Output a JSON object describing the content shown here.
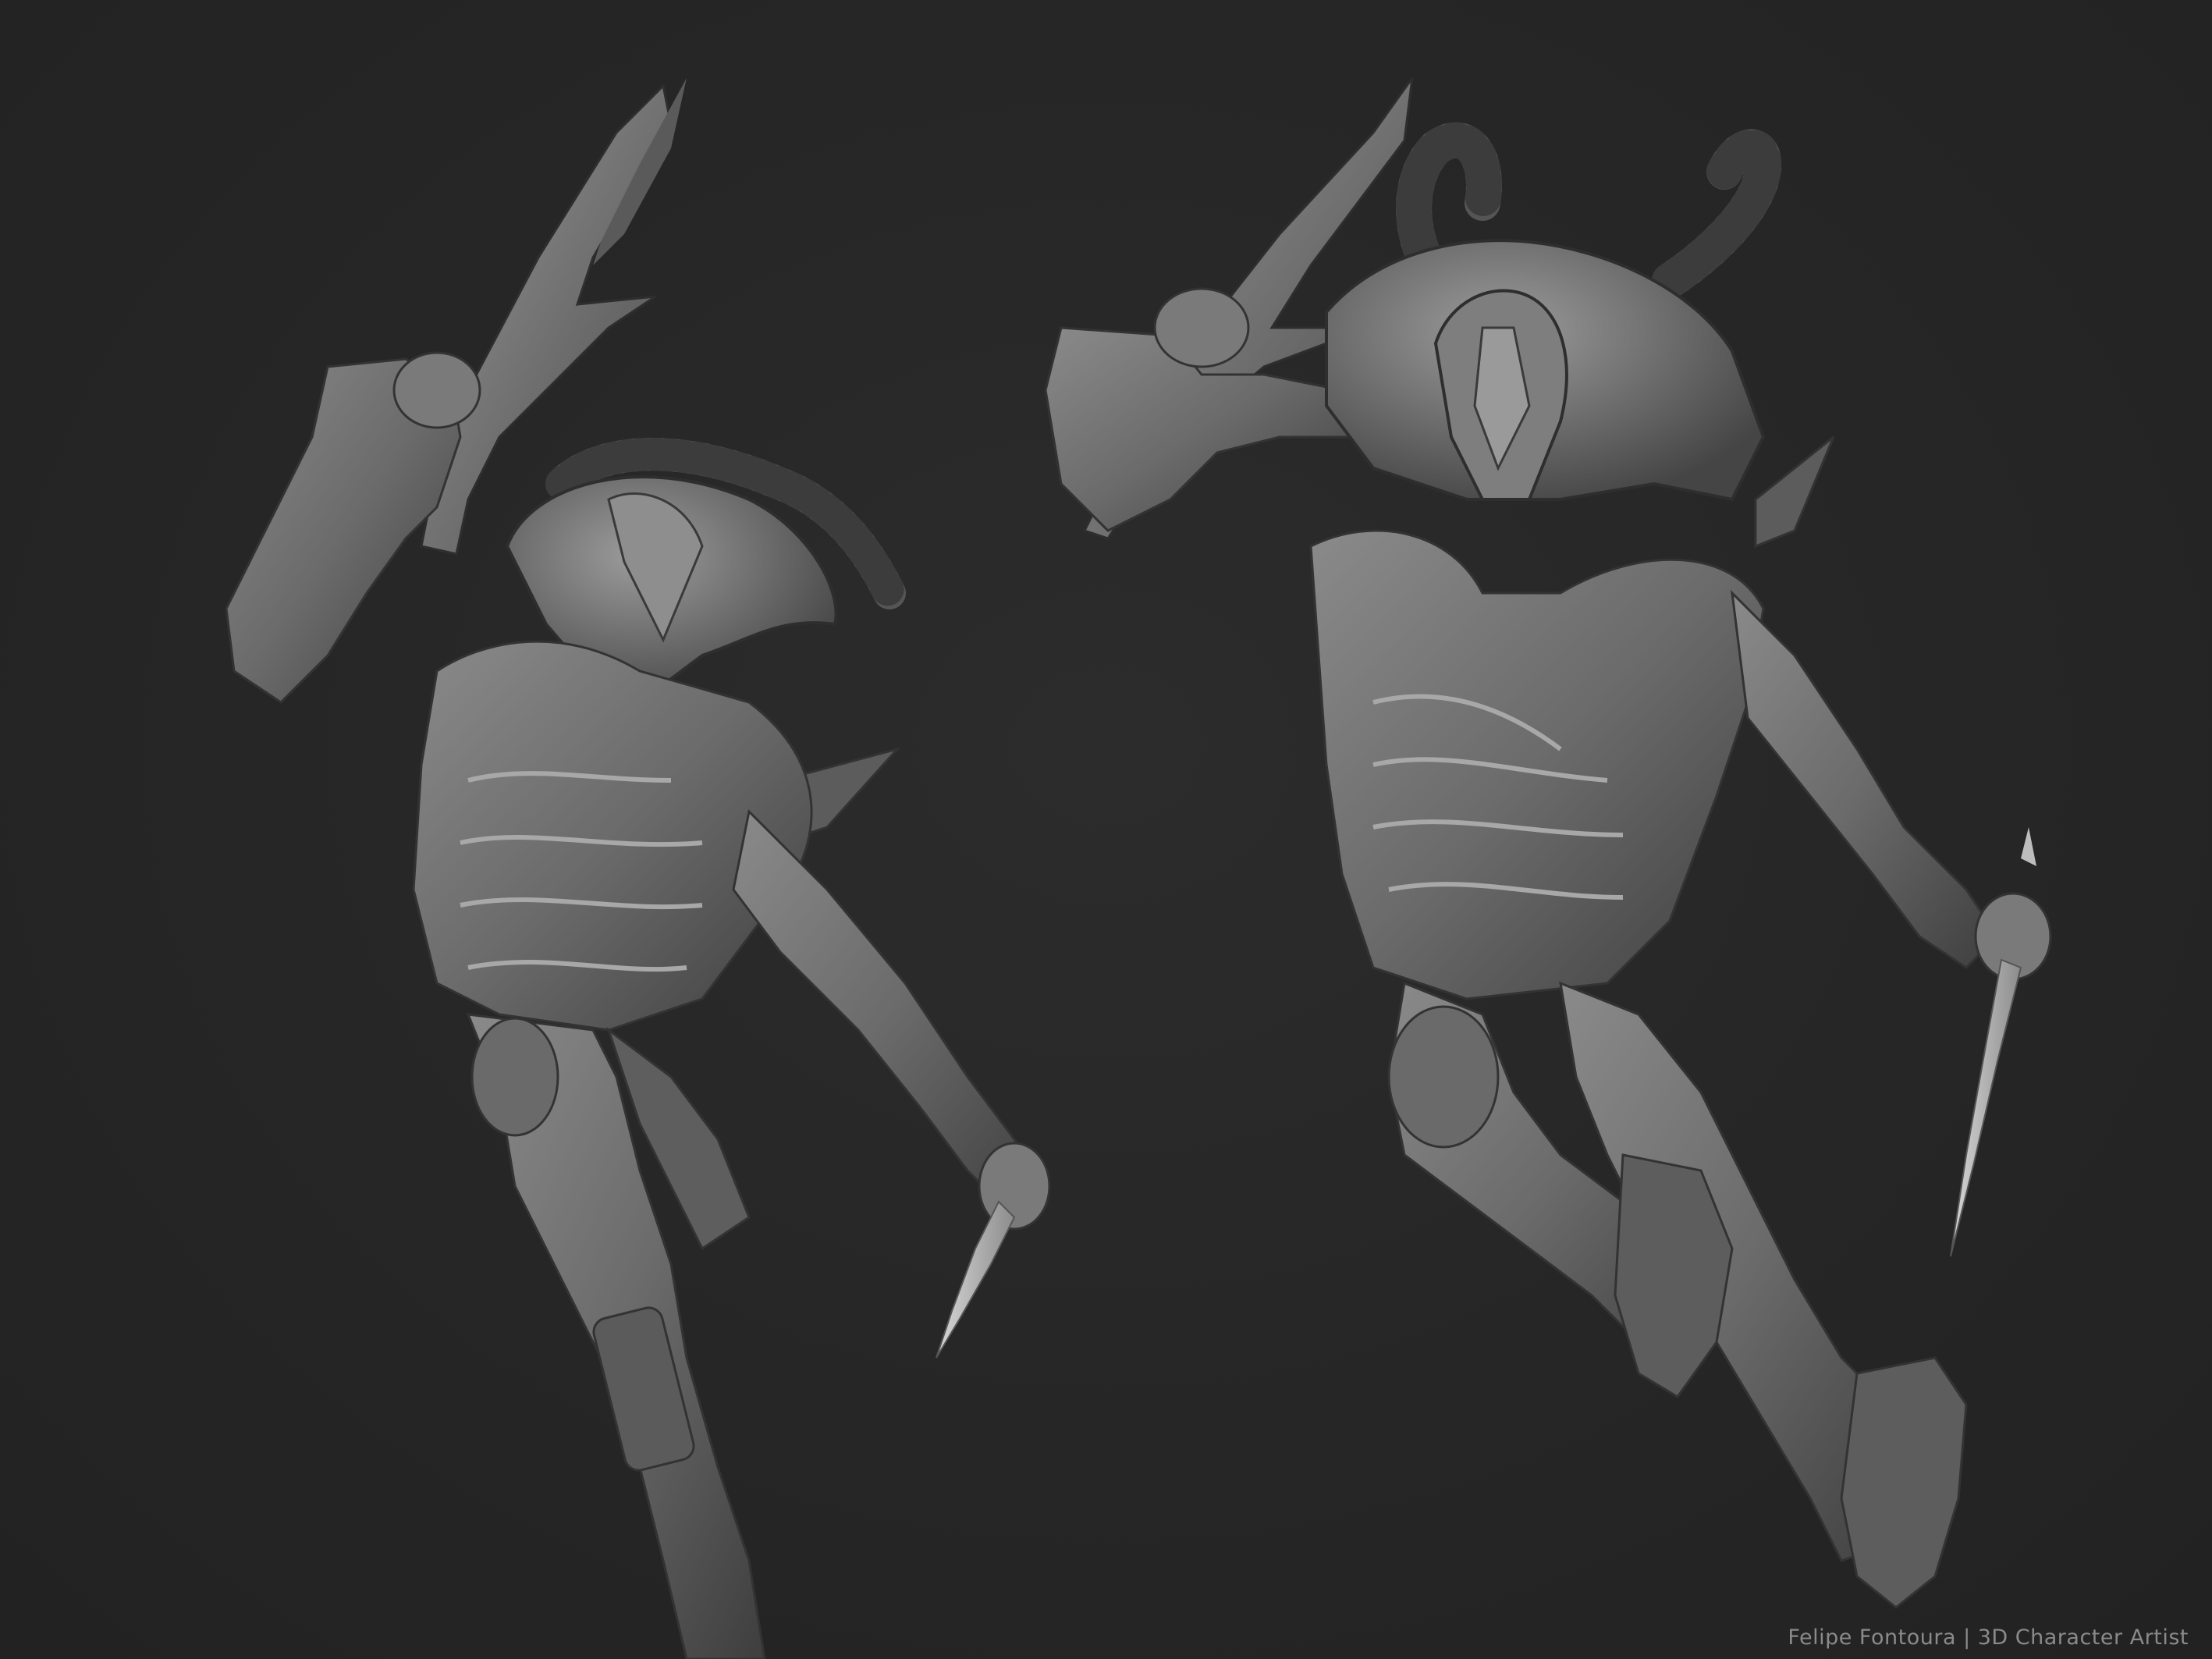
{
  "render": {
    "background_color": "#262626",
    "model_color": "#6e6e6e",
    "model_highlight_color": "#a6a6a6",
    "model_shadow_color": "#3a3a3a",
    "views": [
      {
        "name": "three-quarter-left-view"
      },
      {
        "name": "front-view"
      }
    ]
  },
  "signature": {
    "text": "Felipe Fontoura | 3D Character Artist"
  }
}
